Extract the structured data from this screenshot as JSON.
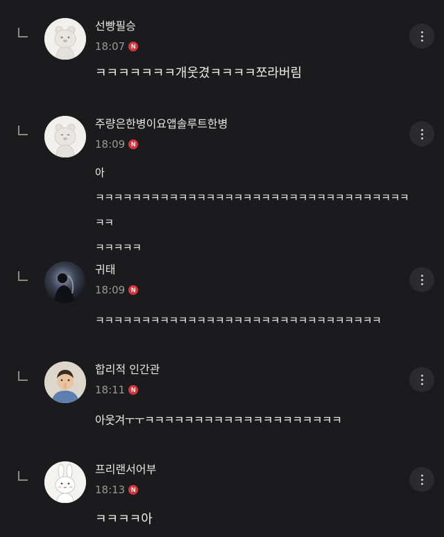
{
  "comments": [
    {
      "nickname": "선빵필승",
      "time": "18:07",
      "badge": "N",
      "text": "ㅋㅋㅋㅋㅋㅋㅋ개웃겼ㅋㅋㅋㅋ쪼라버림",
      "avatar_icon": "bear-avatar-icon"
    },
    {
      "nickname": "주량은한병이요앱솔루트한병",
      "time": "18:09",
      "badge": "N",
      "text": "아\nㅋㅋㅋㅋㅋㅋㅋㅋㅋㅋㅋㅋㅋㅋㅋㅋㅋㅋㅋㅋㅋㅋㅋㅋㅋㅋㅋㅋㅋㅋㅋㅋㅋㅋㅋㅋ\nㅋㅋㅋㅋㅋ",
      "avatar_icon": "bear-avatar-icon"
    },
    {
      "nickname": "귀태",
      "time": "18:09",
      "badge": "N",
      "text": "ㅋㅋㅋㅋㅋㅋㅋㅋㅋㅋㅋㅋㅋㅋㅋㅋㅋㅋㅋㅋㅋㅋㅋㅋㅋㅋㅋㅋㅋㅋㅋ",
      "avatar_icon": "dark-photo-avatar-icon"
    },
    {
      "nickname": "합리적 인간관",
      "time": "18:11",
      "badge": "N",
      "text": "아웃겨ㅜㅜㅋㅋㅋㅋㅋㅋㅋㅋㅋㅋㅋㅋㅋㅋㅋㅋㅋㅋㅋㅋ",
      "avatar_icon": "child-photo-avatar-icon"
    },
    {
      "nickname": "프리랜서어부",
      "time": "18:13",
      "badge": "N",
      "text": "ㅋㅋㅋㅋ아",
      "avatar_icon": "bunny-avatar-icon"
    }
  ],
  "colors": {
    "background": "#1b1b1d",
    "badge": "#d8343c",
    "nickname": "#e6e6e6",
    "time": "#9a9a9a"
  }
}
